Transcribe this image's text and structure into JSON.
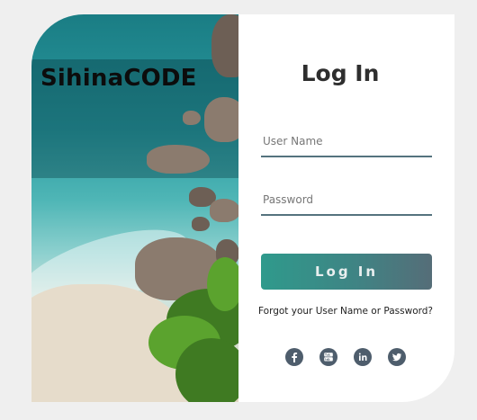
{
  "brand": {
    "name": "SihinaCODE"
  },
  "login": {
    "title": "Log In",
    "username_placeholder": "User Name",
    "password_placeholder": "Password",
    "submit_label": "Log In",
    "forgot_link": "Forgot your User Name or Password?"
  },
  "social": [
    {
      "icon": "facebook-icon"
    },
    {
      "icon": "youtube-icon"
    },
    {
      "icon": "linkedin-icon"
    },
    {
      "icon": "twitter-icon"
    }
  ],
  "colors": {
    "page_background": "#efefef",
    "card_background": "#ffffff",
    "button_gradient_start": "#2f9a8c",
    "button_gradient_end": "#556d78",
    "input_underline": "#55737e",
    "social_icon": "#4e5d6c"
  }
}
